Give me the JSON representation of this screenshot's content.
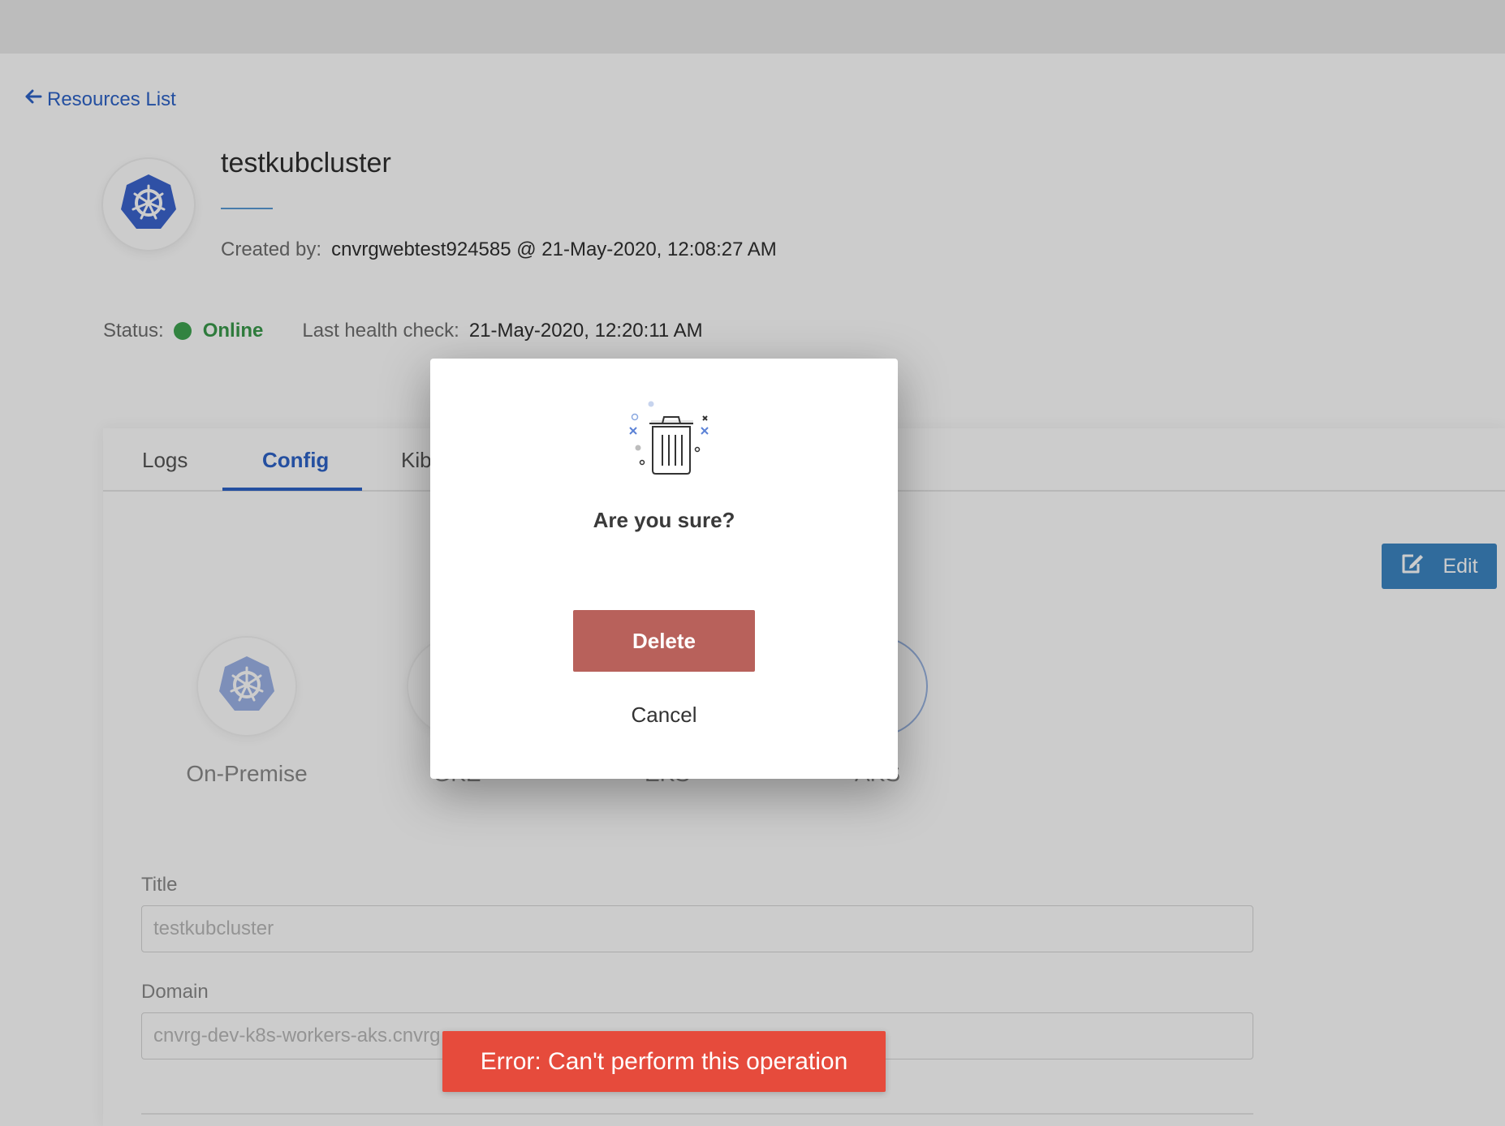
{
  "nav": {
    "back_label": "Resources List"
  },
  "cluster": {
    "name": "testkubcluster",
    "created_label": "Created by:",
    "created_value": "cnvrgwebtest924585 @ 21-May-2020, 12:08:27 AM"
  },
  "status": {
    "label": "Status:",
    "value": "Online",
    "health_label": "Last health check:",
    "health_value": "21-May-2020, 12:20:11 AM"
  },
  "tabs": [
    {
      "label": "Logs"
    },
    {
      "label": "Config",
      "active": true
    },
    {
      "label": "Kib"
    }
  ],
  "edit": {
    "label": "Edit"
  },
  "providers": [
    {
      "label": "On-Premise",
      "selected": false
    },
    {
      "label": "GKE"
    },
    {
      "label": "EKS"
    },
    {
      "label": "AKS",
      "selected": true
    }
  ],
  "form": {
    "title_label": "Title",
    "title_value": "testkubcluster",
    "domain_label": "Domain",
    "domain_value": "cnvrg-dev-k8s-workers-aks.cnvrg"
  },
  "modal": {
    "title": "Are you sure?",
    "delete_label": "Delete",
    "cancel_label": "Cancel"
  },
  "toast": {
    "message": "Error: Can't perform this operation"
  },
  "colors": {
    "accent": "#2d63c8",
    "online": "#3fa451",
    "delete": "#b8615b",
    "error": "#e64b3c",
    "edit": "#3d86c4"
  }
}
